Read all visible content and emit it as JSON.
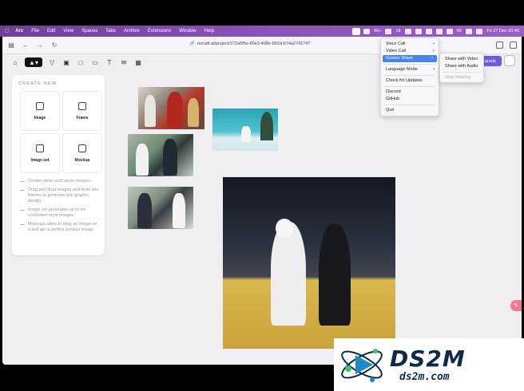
{
  "menubar": {
    "app": "Arc",
    "items": [
      "File",
      "Edit",
      "View",
      "Spaces",
      "Tabs",
      "Archive",
      "Extensions",
      "Window",
      "Help"
    ],
    "status_count1": "99+",
    "status_count2": "18",
    "battery": "6K",
    "clock": "Fri 27 Dec  20:40"
  },
  "browser": {
    "url": "recraft.ai/project/372a5f5e-60e3-408e-801d-b74a2741747"
  },
  "app": {
    "upgrade_label": "grade"
  },
  "panel": {
    "title": "CREATE NEW",
    "cards": [
      {
        "label": "Image",
        "icon": "image-icon"
      },
      {
        "label": "Frame",
        "icon": "frame-icon"
      },
      {
        "label": "Image set",
        "icon": "image-set-icon"
      },
      {
        "label": "Mockup",
        "icon": "shirt-icon"
      }
    ],
    "tips": [
      "Create raster and vector images.",
      "Drag and drop images and texts into frames to generate any graphic design.",
      "Image set generates up to six consistent style images.",
      "Mockups allow to drag an image on it and get a perfect product image."
    ]
  },
  "menu": {
    "items": {
      "voice_call": "Voice Call",
      "video_call": "Video Call",
      "screen_share": "Screen Share",
      "language_mode": "Language Mode",
      "check_updates": "Check for Updates",
      "discord": "Discord",
      "github": "GitHub",
      "quit": "Quit"
    },
    "submenu": {
      "share_video": "Share with Video",
      "share_audio": "Share with Audio",
      "stop_sharing": "Stop Sharing"
    }
  },
  "watermark": {
    "title": "DS2M",
    "subtitle": "ds2m.com"
  },
  "colors": {
    "menubar": "#8a4fb8",
    "accent": "#6d5ae6",
    "highlight": "#4a86e8"
  }
}
